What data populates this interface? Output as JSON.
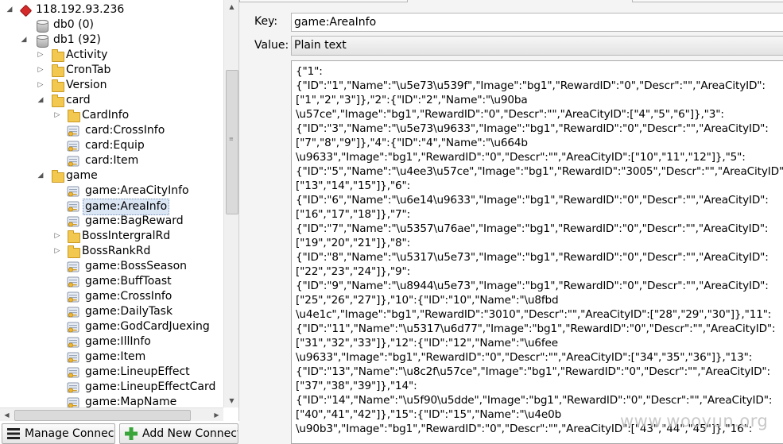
{
  "tree": {
    "nodes": [
      {
        "label": "118.192.93.236",
        "kind": "server",
        "arrow": "expanded"
      },
      {
        "label": "db0 (0)",
        "kind": "db",
        "arrow": "none"
      },
      {
        "label": "db1 (92)",
        "kind": "db",
        "arrow": "expanded"
      },
      {
        "label": "Activity",
        "kind": "folder",
        "arrow": "collapsed"
      },
      {
        "label": "CronTab",
        "kind": "folder",
        "arrow": "collapsed"
      },
      {
        "label": "Version",
        "kind": "folder",
        "arrow": "collapsed"
      },
      {
        "label": "card",
        "kind": "folder",
        "arrow": "expanded"
      },
      {
        "label": "CardInfo",
        "kind": "folder",
        "arrow": "collapsed"
      },
      {
        "label": "card:CrossInfo",
        "kind": "key",
        "arrow": "none"
      },
      {
        "label": "card:Equip",
        "kind": "key",
        "arrow": "none"
      },
      {
        "label": "card:Item",
        "kind": "key",
        "arrow": "none"
      },
      {
        "label": "game",
        "kind": "folder",
        "arrow": "expanded"
      },
      {
        "label": "game:AreaCityInfo",
        "kind": "key",
        "arrow": "none"
      },
      {
        "label": "game:AreaInfo",
        "kind": "key",
        "arrow": "none",
        "selected": true
      },
      {
        "label": "game:BagReward",
        "kind": "key",
        "arrow": "none"
      },
      {
        "label": "BossIntergralRd",
        "kind": "folder",
        "arrow": "collapsed"
      },
      {
        "label": "BossRankRd",
        "kind": "folder",
        "arrow": "collapsed"
      },
      {
        "label": "game:BossSeason",
        "kind": "key",
        "arrow": "none"
      },
      {
        "label": "game:BuffToast",
        "kind": "key",
        "arrow": "none"
      },
      {
        "label": "game:CrossInfo",
        "kind": "key",
        "arrow": "none"
      },
      {
        "label": "game:DailyTask",
        "kind": "key",
        "arrow": "none"
      },
      {
        "label": "game:GodCardJuexing",
        "kind": "key",
        "arrow": "none"
      },
      {
        "label": "game:IllInfo",
        "kind": "key",
        "arrow": "none"
      },
      {
        "label": "game:Item",
        "kind": "key",
        "arrow": "none"
      },
      {
        "label": "game:LineupEffect",
        "kind": "key",
        "arrow": "none"
      },
      {
        "label": "game:LineupEffectCard",
        "kind": "key",
        "arrow": "none"
      },
      {
        "label": "game:MapName",
        "kind": "key",
        "arrow": "none"
      }
    ]
  },
  "buttons": {
    "manage": "Manage Connections",
    "add": "Add New Connection"
  },
  "editor": {
    "key_label": "Key:",
    "key_value": "game:AreaInfo",
    "value_label": "Value:",
    "format": "Plain text",
    "value_lines": [
      "{\"1\":",
      "{\"ID\":\"1\",\"Name\":\"\\u5e73\\u539f\",\"Image\":\"bg1\",\"RewardID\":\"0\",\"Descr\":\"\",\"AreaCityID\":",
      "[\"1\",\"2\",\"3\"]},\"2\":{\"ID\":\"2\",\"Name\":\"\\u90ba",
      "\\u57ce\",\"Image\":\"bg1\",\"RewardID\":\"0\",\"Descr\":\"\",\"AreaCityID\":[\"4\",\"5\",\"6\"]},\"3\":",
      "{\"ID\":\"3\",\"Name\":\"\\u5e73\\u9633\",\"Image\":\"bg1\",\"RewardID\":\"0\",\"Descr\":\"\",\"AreaCityID\":",
      "[\"7\",\"8\",\"9\"]},\"4\":{\"ID\":\"4\",\"Name\":\"\\u664b",
      "\\u9633\",\"Image\":\"bg1\",\"RewardID\":\"0\",\"Descr\":\"\",\"AreaCityID\":[\"10\",\"11\",\"12\"]},\"5\":",
      "{\"ID\":\"5\",\"Name\":\"\\u4ee3\\u57ce\",\"Image\":\"bg1\",\"RewardID\":\"3005\",\"Descr\":\"\",\"AreaCityID\":",
      "[\"13\",\"14\",\"15\"]},\"6\":",
      "{\"ID\":\"6\",\"Name\":\"\\u6e14\\u9633\",\"Image\":\"bg1\",\"RewardID\":\"0\",\"Descr\":\"\",\"AreaCityID\":",
      "[\"16\",\"17\",\"18\"]},\"7\":",
      "{\"ID\":\"7\",\"Name\":\"\\u5357\\u76ae\",\"Image\":\"bg1\",\"RewardID\":\"0\",\"Descr\":\"\",\"AreaCityID\":",
      "[\"19\",\"20\",\"21\"]},\"8\":",
      "{\"ID\":\"8\",\"Name\":\"\\u5317\\u5e73\",\"Image\":\"bg1\",\"RewardID\":\"0\",\"Descr\":\"\",\"AreaCityID\":",
      "[\"22\",\"23\",\"24\"]},\"9\":",
      "{\"ID\":\"9\",\"Name\":\"\\u8944\\u5e73\",\"Image\":\"bg1\",\"RewardID\":\"0\",\"Descr\":\"\",\"AreaCityID\":",
      "[\"25\",\"26\",\"27\"]},\"10\":{\"ID\":\"10\",\"Name\":\"\\u8fbd",
      "\\u4e1c\",\"Image\":\"bg1\",\"RewardID\":\"3010\",\"Descr\":\"\",\"AreaCityID\":[\"28\",\"29\",\"30\"]},\"11\":",
      "{\"ID\":\"11\",\"Name\":\"\\u5317\\u6d77\",\"Image\":\"bg1\",\"RewardID\":\"0\",\"Descr\":\"\",\"AreaCityID\":",
      "[\"31\",\"32\",\"33\"]},\"12\":{\"ID\":\"12\",\"Name\":\"\\u6fee",
      "\\u9633\",\"Image\":\"bg1\",\"RewardID\":\"0\",\"Descr\":\"\",\"AreaCityID\":[\"34\",\"35\",\"36\"]},\"13\":",
      "{\"ID\":\"13\",\"Name\":\"\\u8c2f\\u57ce\",\"Image\":\"bg1\",\"RewardID\":\"0\",\"Descr\":\"\",\"AreaCityID\":",
      "[\"37\",\"38\",\"39\"]},\"14\":",
      "{\"ID\":\"14\",\"Name\":\"\\u5f90\\u5dde\",\"Image\":\"bg1\",\"RewardID\":\"0\",\"Descr\":\"\",\"AreaCityID\":",
      "[\"40\",\"41\",\"42\"]},\"15\":{\"ID\":\"15\",\"Name\":\"\\u4e0b",
      "\\u90b3\",\"Image\":\"bg1\",\"RewardID\":\"0\",\"Descr\":\"\",\"AreaCityID\":[\"43\",\"44\",\"45\"]},\"16\":"
    ]
  },
  "watermark": "www.wooyun.org",
  "colors": {
    "selection": "#dbe6f4",
    "folder": "#f3c850",
    "server": "#d42a2a",
    "add_icon": "#3aa53a"
  }
}
